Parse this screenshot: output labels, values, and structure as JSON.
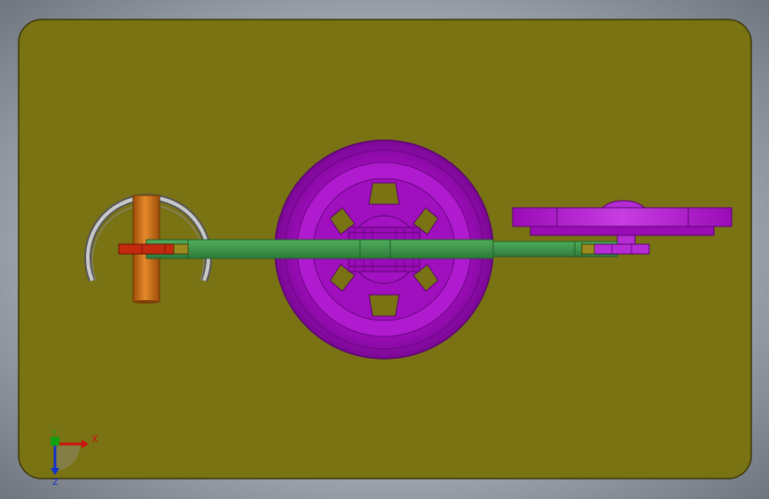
{
  "viewport": {
    "axis_labels": {
      "x": "X",
      "y": "Y",
      "z": "Z"
    }
  },
  "colors": {
    "plate": "#7a7314",
    "plate_edge": "#4a4608",
    "wheel": "#a80fc6",
    "wheel_light": "#c43ee0",
    "wheel_dark": "#6a0680",
    "link": "#3f9a4e",
    "link_dark": "#1f5e2a",
    "pin_orange": "#c86a14",
    "pin_red": "#c42a10",
    "arc_gray": "#8a8a8a",
    "axis_x": "#d01010",
    "axis_y": "#10a010",
    "axis_z": "#1030d0"
  },
  "icons": {
    "triad": "coordinate-triad-icon"
  }
}
